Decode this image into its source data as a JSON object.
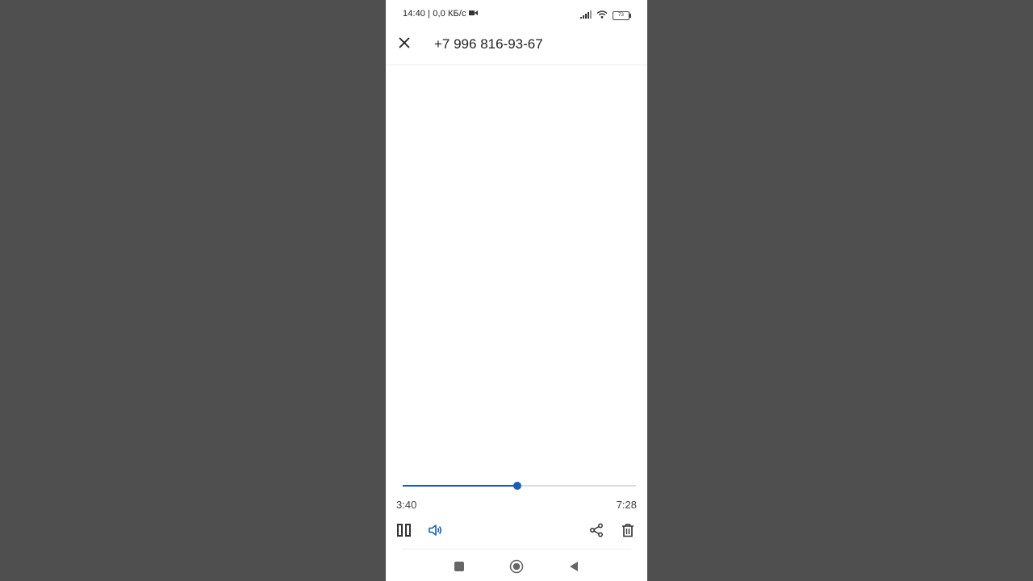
{
  "status_bar": {
    "time_and_speed": "14:40 | 0,0 КБ/с",
    "battery": "73",
    "icons": [
      "video-camera-icon",
      "signal-icon",
      "wifi-icon",
      "battery-icon"
    ]
  },
  "app_bar": {
    "title": "+7 996 816-93-67",
    "close_icon": "close-icon"
  },
  "player": {
    "elapsed": "3:40",
    "total": "7:28",
    "progress": 0.49,
    "accent_color": "#1a5fb4",
    "controls": [
      "pause-icon",
      "speaker-icon",
      "share-icon",
      "delete-icon"
    ]
  },
  "nav_bar": {
    "buttons": [
      "recents-icon",
      "home-icon",
      "back-icon"
    ]
  }
}
